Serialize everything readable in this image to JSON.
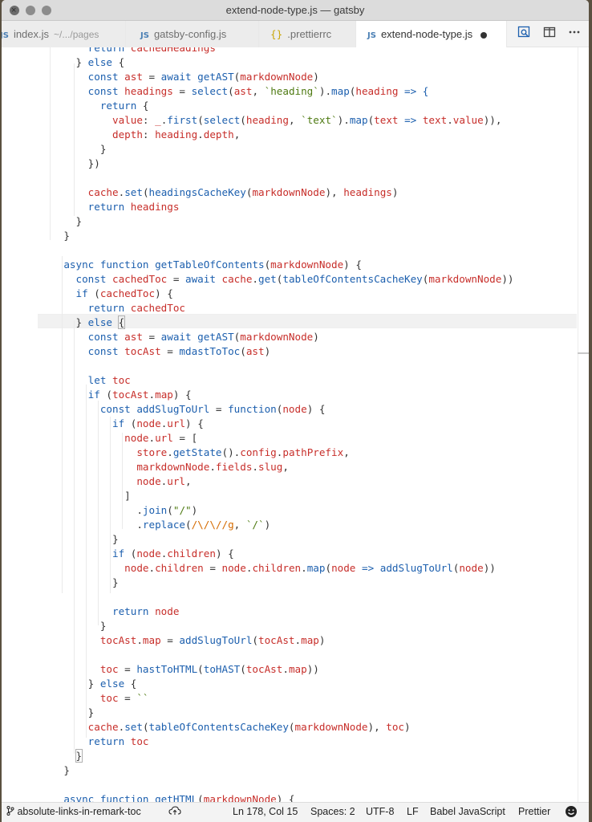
{
  "window": {
    "title": "extend-node-type.js — gatsby"
  },
  "tabs": [
    {
      "icon": "JS",
      "label": "index.js",
      "description": "~/.../pages",
      "active": false
    },
    {
      "icon": "JS",
      "label": "gatsby-config.js",
      "active": false
    },
    {
      "icon": "{}",
      "label": ".prettierrc",
      "active": false
    },
    {
      "icon": "JS",
      "label": "extend-node-type.js",
      "active": true,
      "dirty": true
    }
  ],
  "editor_actions": [
    "open-preview-icon",
    "split-editor-icon",
    "more-actions-icon"
  ],
  "code_lines": [
    [
      [
        "        ",
        ""
      ],
      [
        "return ",
        "k"
      ],
      [
        "cachedHeadings",
        "v"
      ]
    ],
    [
      [
        "      } ",
        "p"
      ],
      [
        "else",
        "k"
      ],
      [
        " {",
        "p"
      ]
    ],
    [
      [
        "        ",
        ""
      ],
      [
        "const ",
        "k"
      ],
      [
        "ast",
        "v"
      ],
      [
        " = ",
        "p"
      ],
      [
        "await ",
        "k"
      ],
      [
        "getAST",
        "f"
      ],
      [
        "(",
        "p"
      ],
      [
        "markdownNode",
        "v"
      ],
      [
        ")",
        "p"
      ]
    ],
    [
      [
        "        ",
        ""
      ],
      [
        "const ",
        "k"
      ],
      [
        "headings",
        "v"
      ],
      [
        " = ",
        "p"
      ],
      [
        "select",
        "f"
      ],
      [
        "(",
        "p"
      ],
      [
        "ast",
        "v"
      ],
      [
        ", ",
        "p"
      ],
      [
        "`heading`",
        "s"
      ],
      [
        ").",
        "p"
      ],
      [
        "map",
        "f"
      ],
      [
        "(",
        "p"
      ],
      [
        "heading",
        "v"
      ],
      [
        " => {",
        "k"
      ]
    ],
    [
      [
        "          ",
        ""
      ],
      [
        "return ",
        "k"
      ],
      [
        "{",
        "p"
      ]
    ],
    [
      [
        "            ",
        ""
      ],
      [
        "value",
        "v"
      ],
      [
        ": ",
        "p"
      ],
      [
        "_",
        "v"
      ],
      [
        ".",
        "p"
      ],
      [
        "first",
        "f"
      ],
      [
        "(",
        "p"
      ],
      [
        "select",
        "f"
      ],
      [
        "(",
        "p"
      ],
      [
        "heading",
        "v"
      ],
      [
        ", ",
        "p"
      ],
      [
        "`text`",
        "s"
      ],
      [
        ").",
        "p"
      ],
      [
        "map",
        "f"
      ],
      [
        "(",
        "p"
      ],
      [
        "text",
        "v"
      ],
      [
        " => ",
        "k"
      ],
      [
        "text",
        "v"
      ],
      [
        ".",
        "p"
      ],
      [
        "value",
        "v"
      ],
      [
        ")),",
        "p"
      ]
    ],
    [
      [
        "            ",
        ""
      ],
      [
        "depth",
        "v"
      ],
      [
        ": ",
        "p"
      ],
      [
        "heading",
        "v"
      ],
      [
        ".",
        "p"
      ],
      [
        "depth",
        "v"
      ],
      [
        ",",
        "p"
      ]
    ],
    [
      [
        "          }",
        "p"
      ]
    ],
    [
      [
        "        })",
        "p"
      ]
    ],
    [
      [
        "",
        ""
      ]
    ],
    [
      [
        "        ",
        ""
      ],
      [
        "cache",
        "v"
      ],
      [
        ".",
        "p"
      ],
      [
        "set",
        "f"
      ],
      [
        "(",
        "p"
      ],
      [
        "headingsCacheKey",
        "f"
      ],
      [
        "(",
        "p"
      ],
      [
        "markdownNode",
        "v"
      ],
      [
        "), ",
        "p"
      ],
      [
        "headings",
        "v"
      ],
      [
        ")",
        "p"
      ]
    ],
    [
      [
        "        ",
        ""
      ],
      [
        "return ",
        "k"
      ],
      [
        "headings",
        "v"
      ]
    ],
    [
      [
        "      }",
        "p"
      ]
    ],
    [
      [
        "    }",
        "p"
      ]
    ],
    [
      [
        "",
        ""
      ]
    ],
    [
      [
        "    ",
        ""
      ],
      [
        "async ",
        "k"
      ],
      [
        "function ",
        "k"
      ],
      [
        "getTableOfContents",
        "f"
      ],
      [
        "(",
        "p"
      ],
      [
        "markdownNode",
        "v"
      ],
      [
        ") {",
        "p"
      ]
    ],
    [
      [
        "      ",
        ""
      ],
      [
        "const ",
        "k"
      ],
      [
        "cachedToc",
        "v"
      ],
      [
        " = ",
        "p"
      ],
      [
        "await ",
        "k"
      ],
      [
        "cache",
        "v"
      ],
      [
        ".",
        "p"
      ],
      [
        "get",
        "f"
      ],
      [
        "(",
        "p"
      ],
      [
        "tableOfContentsCacheKey",
        "f"
      ],
      [
        "(",
        "p"
      ],
      [
        "markdownNode",
        "v"
      ],
      [
        "))",
        "p"
      ]
    ],
    [
      [
        "      ",
        ""
      ],
      [
        "if ",
        "k"
      ],
      [
        "(",
        "p"
      ],
      [
        "cachedToc",
        "v"
      ],
      [
        ") {",
        "p"
      ]
    ],
    [
      [
        "        ",
        ""
      ],
      [
        "return ",
        "k"
      ],
      [
        "cachedToc",
        "v"
      ]
    ],
    [
      [
        "      } ",
        "p"
      ],
      [
        "else ",
        "k"
      ],
      [
        "{",
        "bm"
      ]
    ],
    [
      [
        "        ",
        ""
      ],
      [
        "const ",
        "k"
      ],
      [
        "ast",
        "v"
      ],
      [
        " = ",
        "p"
      ],
      [
        "await ",
        "k"
      ],
      [
        "getAST",
        "f"
      ],
      [
        "(",
        "p"
      ],
      [
        "markdownNode",
        "v"
      ],
      [
        ")",
        "p"
      ]
    ],
    [
      [
        "        ",
        ""
      ],
      [
        "const ",
        "k"
      ],
      [
        "tocAst",
        "v"
      ],
      [
        " = ",
        "p"
      ],
      [
        "mdastToToc",
        "f"
      ],
      [
        "(",
        "p"
      ],
      [
        "ast",
        "v"
      ],
      [
        ")",
        "p"
      ]
    ],
    [
      [
        "",
        ""
      ]
    ],
    [
      [
        "        ",
        ""
      ],
      [
        "let ",
        "k"
      ],
      [
        "toc",
        "v"
      ]
    ],
    [
      [
        "        ",
        ""
      ],
      [
        "if ",
        "k"
      ],
      [
        "(",
        "p"
      ],
      [
        "tocAst",
        "v"
      ],
      [
        ".",
        "p"
      ],
      [
        "map",
        "v"
      ],
      [
        ") {",
        "p"
      ]
    ],
    [
      [
        "          ",
        ""
      ],
      [
        "const ",
        "k"
      ],
      [
        "addSlugToUrl",
        "f"
      ],
      [
        " = ",
        "p"
      ],
      [
        "function",
        "k"
      ],
      [
        "(",
        "p"
      ],
      [
        "node",
        "v"
      ],
      [
        ") {",
        "p"
      ]
    ],
    [
      [
        "            ",
        ""
      ],
      [
        "if ",
        "k"
      ],
      [
        "(",
        "p"
      ],
      [
        "node",
        "v"
      ],
      [
        ".",
        "p"
      ],
      [
        "url",
        "v"
      ],
      [
        ") {",
        "p"
      ]
    ],
    [
      [
        "              ",
        ""
      ],
      [
        "node",
        "v"
      ],
      [
        ".",
        "p"
      ],
      [
        "url",
        "v"
      ],
      [
        " = [",
        "p"
      ]
    ],
    [
      [
        "                ",
        ""
      ],
      [
        "store",
        "v"
      ],
      [
        ".",
        "p"
      ],
      [
        "getState",
        "f"
      ],
      [
        "().",
        "p"
      ],
      [
        "config",
        "v"
      ],
      [
        ".",
        "p"
      ],
      [
        "pathPrefix",
        "v"
      ],
      [
        ",",
        "p"
      ]
    ],
    [
      [
        "                ",
        ""
      ],
      [
        "markdownNode",
        "v"
      ],
      [
        ".",
        "p"
      ],
      [
        "fields",
        "v"
      ],
      [
        ".",
        "p"
      ],
      [
        "slug",
        "v"
      ],
      [
        ",",
        "p"
      ]
    ],
    [
      [
        "                ",
        ""
      ],
      [
        "node",
        "v"
      ],
      [
        ".",
        "p"
      ],
      [
        "url",
        "v"
      ],
      [
        ",",
        "p"
      ]
    ],
    [
      [
        "              ]",
        "p"
      ]
    ],
    [
      [
        "                ",
        ""
      ],
      [
        ".",
        "p"
      ],
      [
        "join",
        "f"
      ],
      [
        "(",
        "p"
      ],
      [
        "\"/\"",
        "s"
      ],
      [
        ")",
        "p"
      ]
    ],
    [
      [
        "                ",
        ""
      ],
      [
        ".",
        "p"
      ],
      [
        "replace",
        "f"
      ],
      [
        "(",
        "p"
      ],
      [
        "/\\/\\//g",
        "rx"
      ],
      [
        ", ",
        "p"
      ],
      [
        "`/`",
        "s"
      ],
      [
        ")",
        "p"
      ]
    ],
    [
      [
        "            }",
        "p"
      ]
    ],
    [
      [
        "            ",
        ""
      ],
      [
        "if ",
        "k"
      ],
      [
        "(",
        "p"
      ],
      [
        "node",
        "v"
      ],
      [
        ".",
        "p"
      ],
      [
        "children",
        "v"
      ],
      [
        ") {",
        "p"
      ]
    ],
    [
      [
        "              ",
        ""
      ],
      [
        "node",
        "v"
      ],
      [
        ".",
        "p"
      ],
      [
        "children",
        "v"
      ],
      [
        " = ",
        "p"
      ],
      [
        "node",
        "v"
      ],
      [
        ".",
        "p"
      ],
      [
        "children",
        "v"
      ],
      [
        ".",
        "p"
      ],
      [
        "map",
        "f"
      ],
      [
        "(",
        "p"
      ],
      [
        "node",
        "v"
      ],
      [
        " => ",
        "k"
      ],
      [
        "addSlugToUrl",
        "f"
      ],
      [
        "(",
        "p"
      ],
      [
        "node",
        "v"
      ],
      [
        "))",
        "p"
      ]
    ],
    [
      [
        "            }",
        "p"
      ]
    ],
    [
      [
        "",
        ""
      ]
    ],
    [
      [
        "            ",
        ""
      ],
      [
        "return ",
        "k"
      ],
      [
        "node",
        "v"
      ]
    ],
    [
      [
        "          }",
        "p"
      ]
    ],
    [
      [
        "          ",
        ""
      ],
      [
        "tocAst",
        "v"
      ],
      [
        ".",
        "p"
      ],
      [
        "map",
        "v"
      ],
      [
        " = ",
        "p"
      ],
      [
        "addSlugToUrl",
        "f"
      ],
      [
        "(",
        "p"
      ],
      [
        "tocAst",
        "v"
      ],
      [
        ".",
        "p"
      ],
      [
        "map",
        "v"
      ],
      [
        ")",
        "p"
      ]
    ],
    [
      [
        "",
        ""
      ]
    ],
    [
      [
        "          ",
        ""
      ],
      [
        "toc",
        "v"
      ],
      [
        " = ",
        "p"
      ],
      [
        "hastToHTML",
        "f"
      ],
      [
        "(",
        "p"
      ],
      [
        "toHAST",
        "f"
      ],
      [
        "(",
        "p"
      ],
      [
        "tocAst",
        "v"
      ],
      [
        ".",
        "p"
      ],
      [
        "map",
        "v"
      ],
      [
        "))",
        "p"
      ]
    ],
    [
      [
        "        } ",
        "p"
      ],
      [
        "else ",
        "k"
      ],
      [
        "{",
        "p"
      ]
    ],
    [
      [
        "          ",
        ""
      ],
      [
        "toc",
        "v"
      ],
      [
        " = ",
        "p"
      ],
      [
        "``",
        "s"
      ]
    ],
    [
      [
        "        }",
        "p"
      ]
    ],
    [
      [
        "        ",
        ""
      ],
      [
        "cache",
        "v"
      ],
      [
        ".",
        "p"
      ],
      [
        "set",
        "f"
      ],
      [
        "(",
        "p"
      ],
      [
        "tableOfContentsCacheKey",
        "f"
      ],
      [
        "(",
        "p"
      ],
      [
        "markdownNode",
        "v"
      ],
      [
        "), ",
        "p"
      ],
      [
        "toc",
        "v"
      ],
      [
        ")",
        "p"
      ]
    ],
    [
      [
        "        ",
        ""
      ],
      [
        "return ",
        "k"
      ],
      [
        "toc",
        "v"
      ]
    ],
    [
      [
        "      ",
        ""
      ],
      [
        "}",
        "bm"
      ]
    ],
    [
      [
        "    }",
        "p"
      ]
    ],
    [
      [
        "",
        ""
      ]
    ],
    [
      [
        "    ",
        ""
      ],
      [
        "async ",
        "k"
      ],
      [
        "function ",
        "k"
      ],
      [
        "getHTML",
        "f"
      ],
      [
        "(",
        "p"
      ],
      [
        "markdownNode",
        "v"
      ],
      [
        ") {",
        "p"
      ]
    ]
  ],
  "status": {
    "branch": "absolute-links-in-remark-toc",
    "sync_icon": "cloud-upload-icon",
    "position": "Ln 178, Col 15",
    "spaces": "Spaces: 2",
    "encoding": "UTF-8",
    "eol": "LF",
    "language": "Babel JavaScript",
    "formatter": "Prettier",
    "feedback_icon": "smiley-icon"
  }
}
